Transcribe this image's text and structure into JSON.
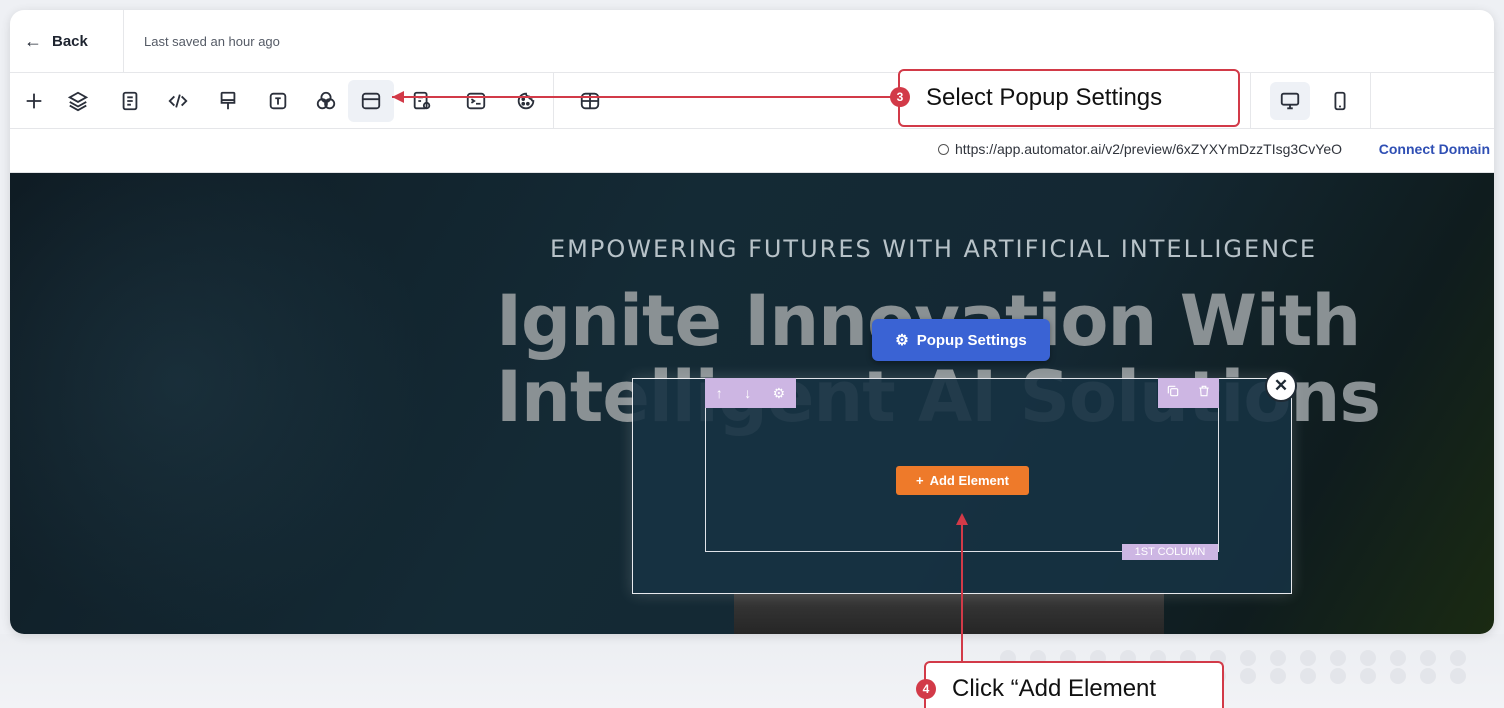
{
  "topbar": {
    "back_label": "Back",
    "saved_text": "Last saved an hour ago"
  },
  "toolbar": {
    "tools": [
      "add-icon",
      "layers-icon",
      "page-icon",
      "code-icon",
      "brush-icon",
      "text-icon",
      "blend-icon",
      "popup-settings-icon",
      "search-doc-icon",
      "terminal-icon",
      "cookie-icon",
      "columns-icon"
    ],
    "devices": [
      "desktop-icon",
      "mobile-icon"
    ]
  },
  "urlbar": {
    "url": "https://app.automator.ai/v2/preview/6xZYXYmDzzTIsg3CvYeO",
    "connect_label": "Connect Domain"
  },
  "canvas": {
    "eyebrow": "EMPOWERING FUTURES WITH ARTIFICIAL INTELLIGENCE",
    "headline_line1": "Ignite Innovation With",
    "headline_line2": "Intelligent AI Solutions"
  },
  "popup": {
    "settings_label": "Popup Settings",
    "add_element_label": "Add Element",
    "column_label": "1ST COLUMN"
  },
  "callouts": {
    "step3_number": "3",
    "step3_text": "Select Popup Settings",
    "step4_number": "4",
    "step4_text": "Click “Add Element"
  },
  "colors": {
    "accent_blue": "#3a63d4",
    "orange": "#ee7a2a",
    "callout_red": "#d23a48",
    "row_purple": "#cdb6e3"
  }
}
